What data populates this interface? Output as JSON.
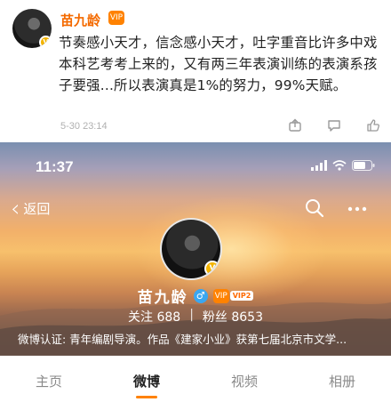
{
  "post": {
    "author": "苗九龄",
    "vip_badge": "VIP",
    "avatar_badge": "V",
    "text": "节奏感小天才，信念感小天才，吐字重音比许多中戏本科艺考考上来的，又有两三年表演训练的表演系孩子要强...所以表演真是1%的努力，99%天赋。",
    "timestamp": "5-30 23:14",
    "icons": [
      "share-icon",
      "comment-icon",
      "like-icon"
    ]
  },
  "profile": {
    "status_time": "11:37",
    "back_label": "返回",
    "name": "苗九龄",
    "gender_symbol": "♂",
    "vip_level": "VIP2",
    "follow_label": "关注",
    "follow_count": "688",
    "separator": "|",
    "fans_label": "粉丝",
    "fans_count": "8653",
    "verification": "微博认证: 青年编剧导演。作品《建家小业》获第七届北京市文学..."
  },
  "tabs": [
    {
      "label": "主页",
      "active": false
    },
    {
      "label": "微博",
      "active": true
    },
    {
      "label": "视频",
      "active": false
    },
    {
      "label": "相册",
      "active": false
    }
  ],
  "colors": {
    "accent": "#ff8200",
    "name_orange": "#f46a00",
    "verified_gold": "#f3b400"
  }
}
